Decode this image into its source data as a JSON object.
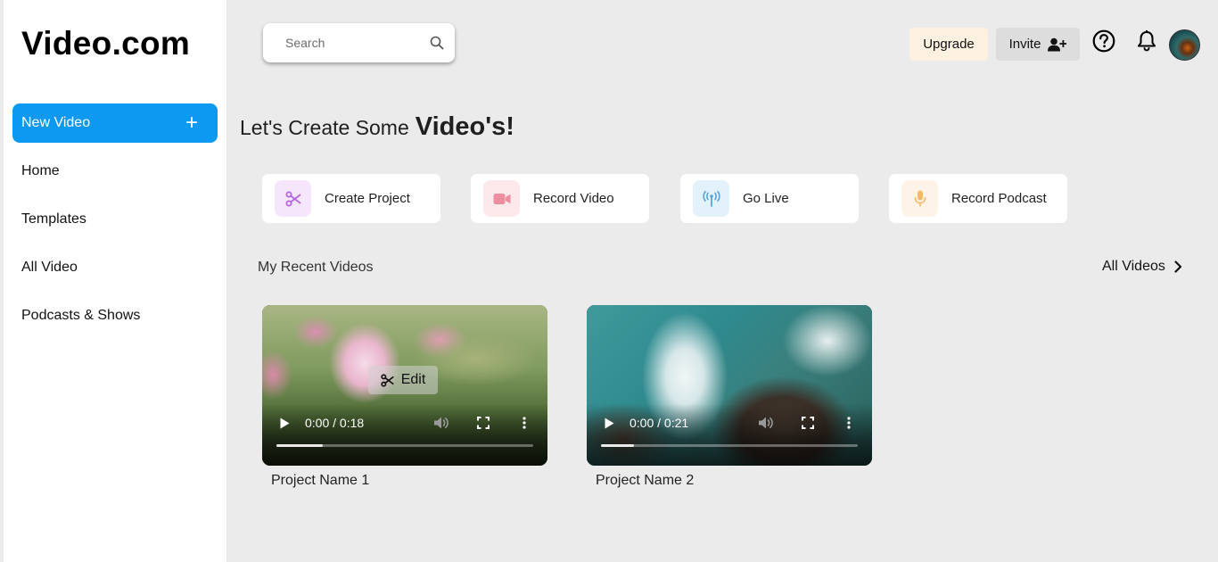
{
  "brand": {
    "logo": "Video.com"
  },
  "sidebar": {
    "new_video_label": "New Video",
    "items": [
      {
        "label": "Home"
      },
      {
        "label": "Templates"
      },
      {
        "label": "All Video"
      },
      {
        "label": "Podcasts & Shows"
      }
    ]
  },
  "topbar": {
    "search_placeholder": "Search",
    "upgrade_label": "Upgrade",
    "invite_label": "Invite"
  },
  "heading": {
    "prefix": "Let's Create Some",
    "bold": "Video's!"
  },
  "actions": [
    {
      "label": "Create Project",
      "icon": "scissors-icon",
      "icon_color": "#b466e0",
      "icon_bg": "#f5e6fc"
    },
    {
      "label": "Record Video",
      "icon": "video-camera-icon",
      "icon_color": "#ec8e9f",
      "icon_bg": "#fde8ec"
    },
    {
      "label": "Go Live",
      "icon": "broadcast-antenna-icon",
      "icon_color": "#5aa4d6",
      "icon_bg": "#e3f1fb"
    },
    {
      "label": "Record Podcast",
      "icon": "microphone-icon",
      "icon_color": "#f3b968",
      "icon_bg": "#fdf3e6"
    }
  ],
  "recent": {
    "title": "My Recent Videos",
    "all_link": "All Videos",
    "videos": [
      {
        "name": "Project Name 1",
        "time": "0:00 / 0:18",
        "progress": 0.18,
        "edit_label": "Edit"
      },
      {
        "name": "Project Name 2",
        "time": "0:00 / 0:21",
        "progress": 0.13
      }
    ]
  },
  "colors": {
    "accent": "#0d99f2",
    "background": "#ebebeb",
    "upgrade_bg": "#fdf1e2",
    "invite_bg": "#dddddd"
  }
}
